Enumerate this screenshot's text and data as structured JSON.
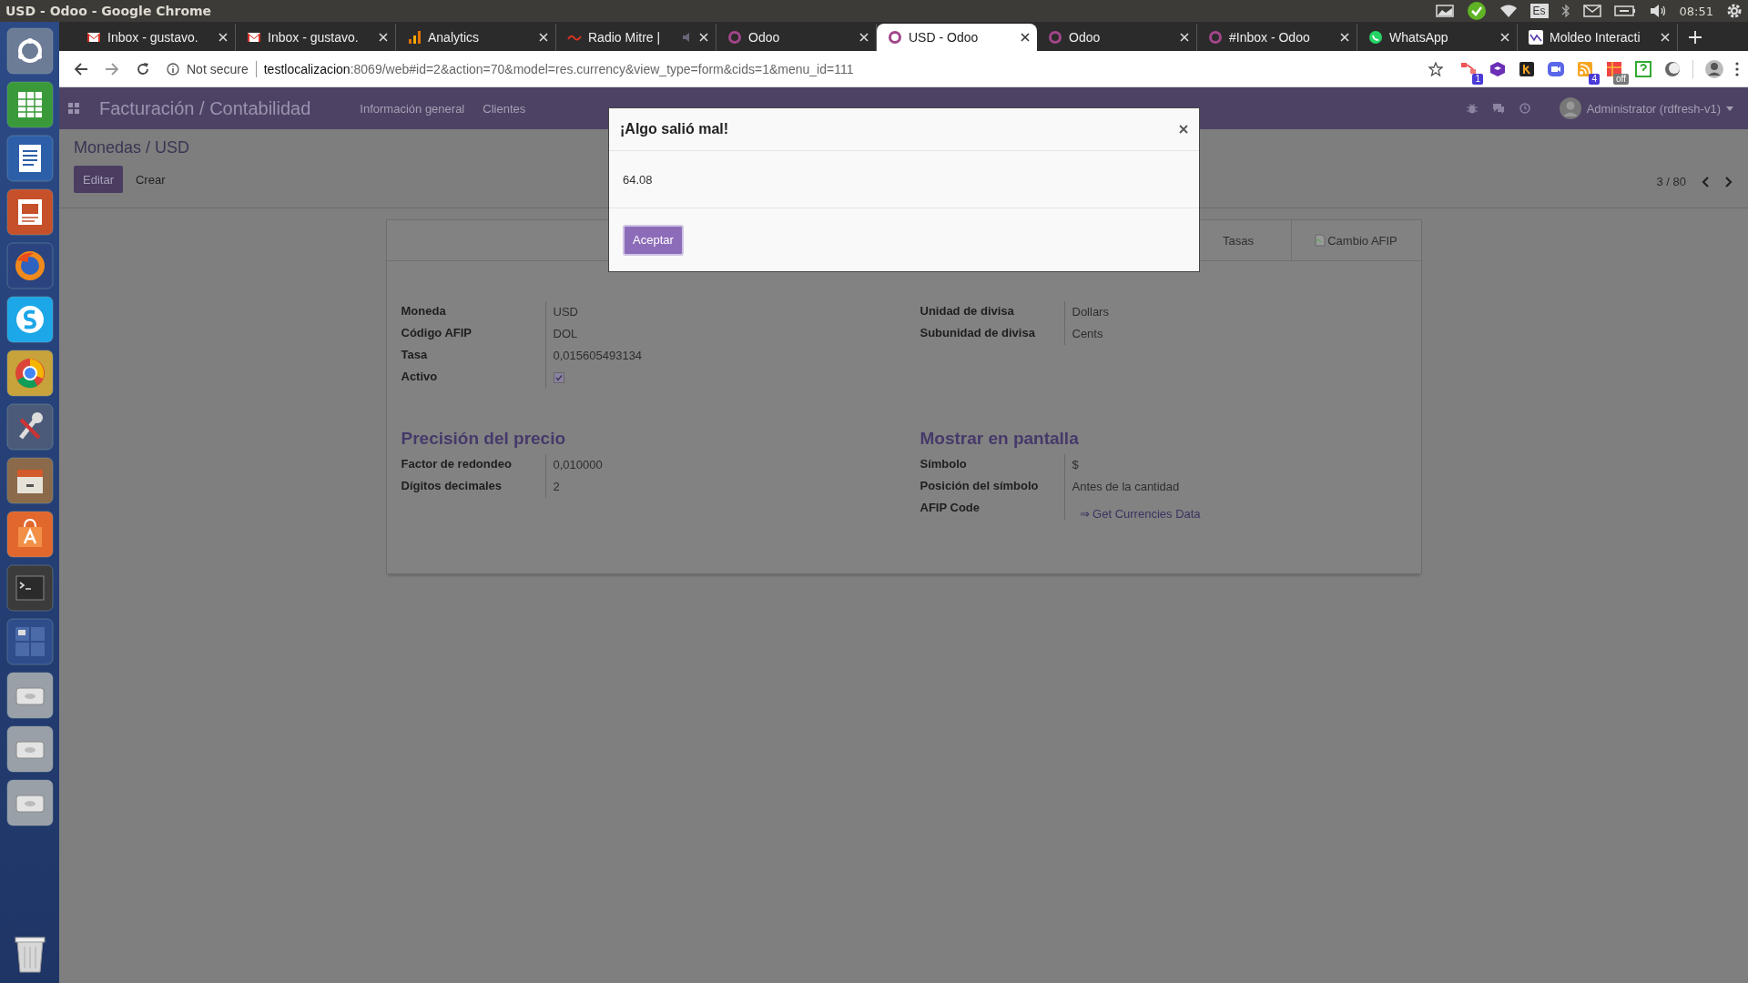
{
  "system_bar": {
    "title": "USD - Odoo - Google Chrome",
    "keyboard_layout": "Es",
    "time": "08:51"
  },
  "browser": {
    "tabs": [
      {
        "title": "Inbox - gustavo.",
        "kind": "mail",
        "audio": false,
        "selected": false
      },
      {
        "title": "Inbox - gustavo.",
        "kind": "mail",
        "audio": false,
        "selected": false
      },
      {
        "title": "Analytics",
        "kind": "bars",
        "audio": false,
        "selected": false
      },
      {
        "title": "Radio Mitre |",
        "kind": "radio",
        "audio": true,
        "selected": false
      },
      {
        "title": "Odoo",
        "kind": "ring",
        "audio": false,
        "selected": false
      },
      {
        "title": "USD - Odoo",
        "kind": "ring",
        "audio": false,
        "selected": true
      },
      {
        "title": "Odoo",
        "kind": "ring",
        "audio": false,
        "selected": false
      },
      {
        "title": "#Inbox - Odoo",
        "kind": "ring",
        "audio": false,
        "selected": false
      },
      {
        "title": "WhatsApp",
        "kind": "chat",
        "audio": false,
        "selected": false
      },
      {
        "title": "Moldeo Interacti",
        "kind": "wave",
        "audio": false,
        "selected": false
      }
    ],
    "address": {
      "security": "Not secure",
      "host": "testlocalizacion",
      "path": ":8069/web#id=2&action=70&model=res.currency&view_type=form&cids=1&menu_id=111"
    },
    "extensions": [
      {
        "kind": "flow",
        "badge": "1"
      },
      {
        "kind": "cube"
      },
      {
        "kind": "k"
      },
      {
        "kind": "camera"
      },
      {
        "kind": "feed",
        "badge": "4"
      },
      {
        "kind": "grid",
        "badge": "off"
      },
      {
        "kind": "help"
      },
      {
        "kind": "moon"
      }
    ]
  },
  "odoo": {
    "app_title": "Facturación / Contabilidad",
    "menu": [
      "Información general",
      "Clientes"
    ],
    "user": "Administrator (rdfresh-v1)",
    "breadcrumb": "Monedas / USD",
    "buttons": [
      {
        "label": "Editar",
        "kind": "primary"
      },
      {
        "label": "Crear",
        "kind": "plain"
      }
    ],
    "pager": "3 / 80",
    "smart_buttons": [
      {
        "label": "Tasas",
        "kind": "text"
      },
      {
        "label": "Cambio AFIP",
        "kind": "broken_image"
      }
    ],
    "groups": [
      {
        "fields": [
          {
            "label": "Moneda",
            "value": "USD",
            "kind": "text"
          },
          {
            "label": "Código AFIP",
            "value": "DOL",
            "kind": "text"
          },
          {
            "label": "Tasa",
            "value": "0,015605493134",
            "kind": "text"
          },
          {
            "label": "Activo",
            "kind": "checkbox",
            "checked": true
          }
        ]
      },
      {
        "fields": [
          {
            "label": "Unidad de divisa",
            "value": "Dollars",
            "kind": "text"
          },
          {
            "label": "Subunidad de divisa",
            "value": "Cents",
            "kind": "text"
          }
        ]
      },
      {
        "title": "Precisión del precio",
        "fields": [
          {
            "label": "Factor de redondeo",
            "value": "0,010000",
            "kind": "text"
          },
          {
            "label": "Dígitos decimales",
            "value": "2",
            "kind": "text"
          }
        ]
      },
      {
        "title": "Mostrar en pantalla",
        "fields": [
          {
            "label": "Símbolo",
            "value": "$",
            "kind": "text"
          },
          {
            "label": "Posición del símbolo",
            "value": "Antes de la cantidad",
            "kind": "text"
          },
          {
            "label": "AFIP Code",
            "value": "⇒ Get Currencies Data",
            "kind": "link"
          }
        ]
      }
    ]
  },
  "dialog": {
    "title": "¡Algo salió mal!",
    "message": "64.08",
    "buttons": [
      "Aceptar"
    ]
  }
}
